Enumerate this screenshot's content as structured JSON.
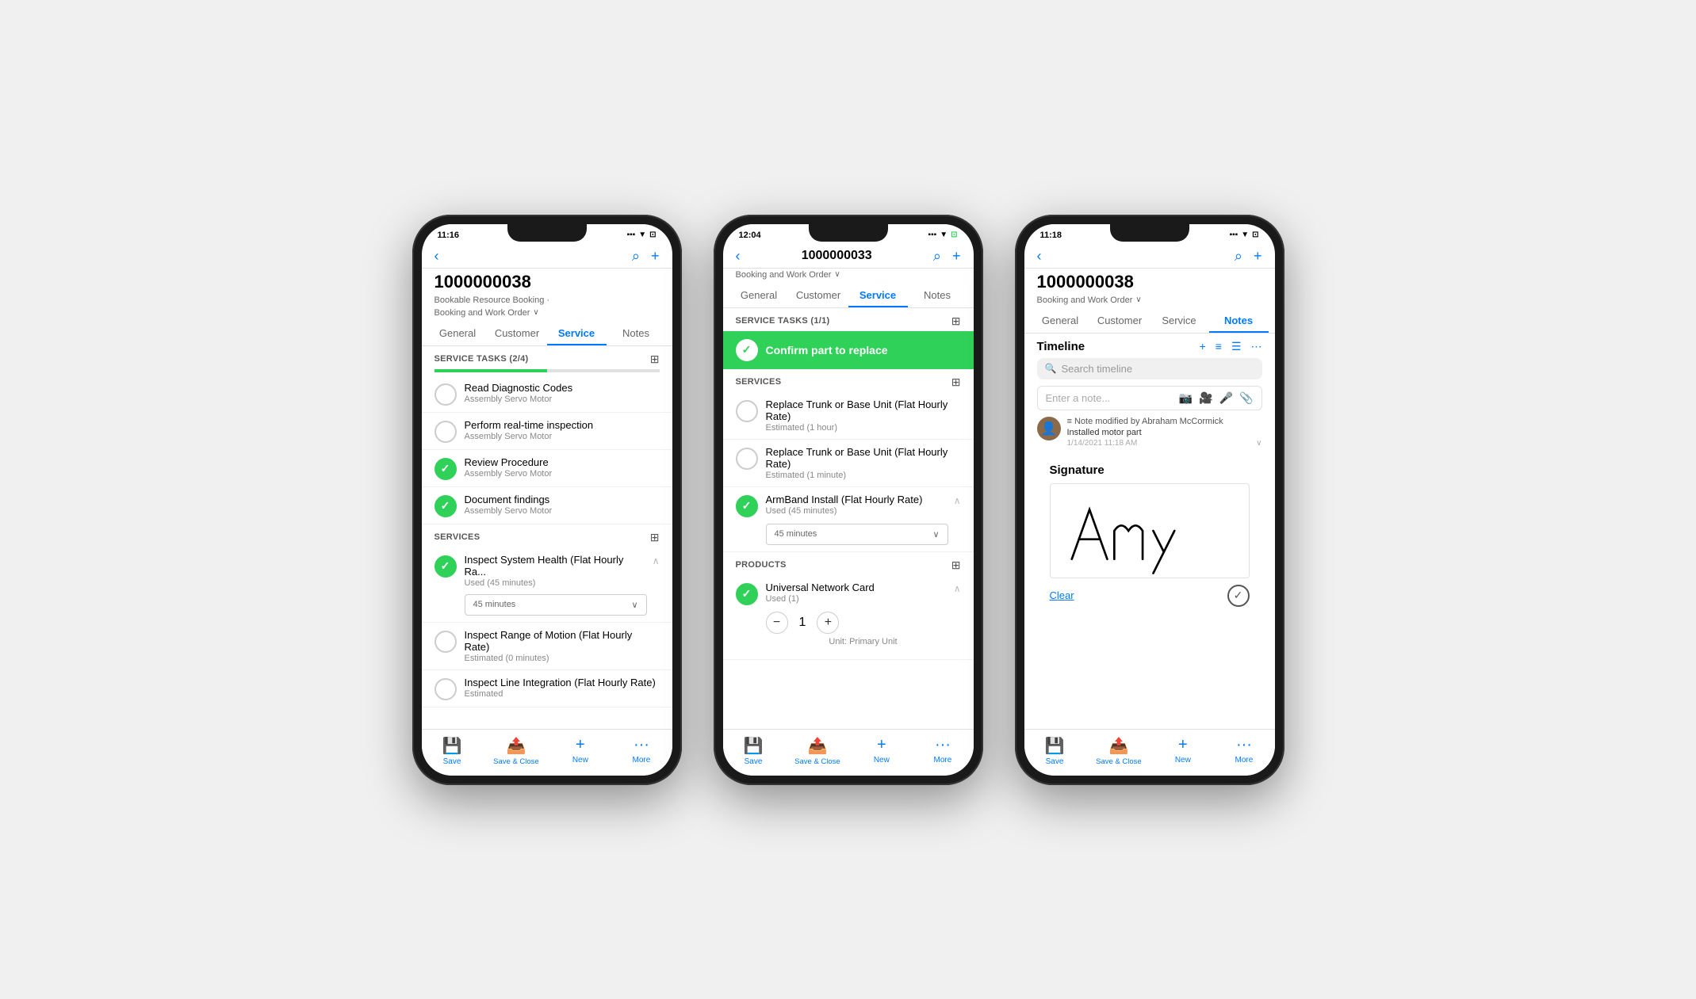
{
  "scene": {
    "background": "#e8e8e8"
  },
  "phone1": {
    "status_time": "11:16",
    "status_right": "signal wifi battery",
    "header": {
      "back": "‹",
      "title": "1000000038",
      "search_icon": "🔍",
      "add_icon": "+"
    },
    "subtitle1": "Bookable Resource Booking ·",
    "subtitle2": "Booking and Work Order",
    "tabs": [
      "General",
      "Customer",
      "Service",
      "Notes"
    ],
    "active_tab": 2,
    "service_tasks_label": "SERVICE TASKS (2/4)",
    "progress": 50,
    "tasks": [
      {
        "name": "Read Diagnostic Codes",
        "sub": "Assembly Servo Motor",
        "done": false
      },
      {
        "name": "Perform real-time inspection",
        "sub": "Assembly Servo Motor",
        "done": false
      },
      {
        "name": "Review Procedure",
        "sub": "Assembly Servo Motor",
        "done": true
      },
      {
        "name": "Document findings",
        "sub": "Assembly Servo Motor",
        "done": true
      }
    ],
    "services_label": "SERVICES",
    "services": [
      {
        "name": "Inspect System Health (Flat Hourly Ra...",
        "sub": "Used (45 minutes)",
        "done": true,
        "expanded": true,
        "dropdown": "45 minutes"
      },
      {
        "name": "Inspect Range of Motion (Flat Hourly Rate)",
        "sub": "Estimated (0 minutes)",
        "done": false,
        "expanded": false
      },
      {
        "name": "Inspect Line Integration (Flat Hourly Rate)",
        "sub": "Estimated",
        "done": false,
        "expanded": false
      }
    ],
    "bottom_bar": [
      "Save",
      "Save & Close",
      "New",
      "More"
    ]
  },
  "phone2": {
    "status_time": "12:04",
    "header": {
      "back": "‹",
      "title": "1000000033",
      "search_icon": "🔍",
      "add_icon": "+"
    },
    "subtitle2": "Booking and Work Order",
    "tabs": [
      "General",
      "Customer",
      "Service",
      "Notes"
    ],
    "active_tab": 2,
    "service_tasks_label": "SERVICE TASKS (1/1)",
    "confirmed_task": "Confirm part to replace",
    "services_label": "SERVICES",
    "services": [
      {
        "name": "Replace Trunk or Base Unit (Flat Hourly Rate)",
        "sub": "Estimated (1 hour)",
        "done": false,
        "expanded": false
      },
      {
        "name": "Replace Trunk or Base Unit (Flat Hourly Rate)",
        "sub": "Estimated (1 minute)",
        "done": false,
        "expanded": false
      },
      {
        "name": "ArmBand Install (Flat Hourly Rate)",
        "sub": "Used (45 minutes)",
        "done": true,
        "expanded": true,
        "dropdown": "45 minutes"
      }
    ],
    "products_label": "PRODUCTS",
    "products": [
      {
        "name": "Universal Network Card",
        "sub": "Used (1)",
        "done": true,
        "qty": 1,
        "unit": "Unit: Primary Unit"
      }
    ],
    "bottom_bar": [
      "Save",
      "Save & Close",
      "New",
      "More"
    ]
  },
  "phone3": {
    "status_time": "11:18",
    "header": {
      "back": "‹",
      "title": "1000000038",
      "search_icon": "🔍",
      "add_icon": "+"
    },
    "subtitle2": "Booking and Work Order",
    "tabs": [
      "General",
      "Customer",
      "Service",
      "Notes"
    ],
    "active_tab": 3,
    "timeline_title": "Timeline",
    "timeline_actions": [
      "+",
      "filter",
      "list",
      "..."
    ],
    "search_placeholder": "Search timeline",
    "note_placeholder": "Enter a note...",
    "note_icons": [
      "📷",
      "🎥",
      "🎤",
      "📎"
    ],
    "note": {
      "author": "Note modified by Abraham McCormick",
      "body": "Installed motor part",
      "timestamp": "1/14/2021 11:18 AM"
    },
    "signature_title": "Signature",
    "signature_text": "Amy",
    "clear_label": "Clear",
    "bottom_bar": [
      "Save",
      "Save & Close",
      "New",
      "More"
    ]
  }
}
